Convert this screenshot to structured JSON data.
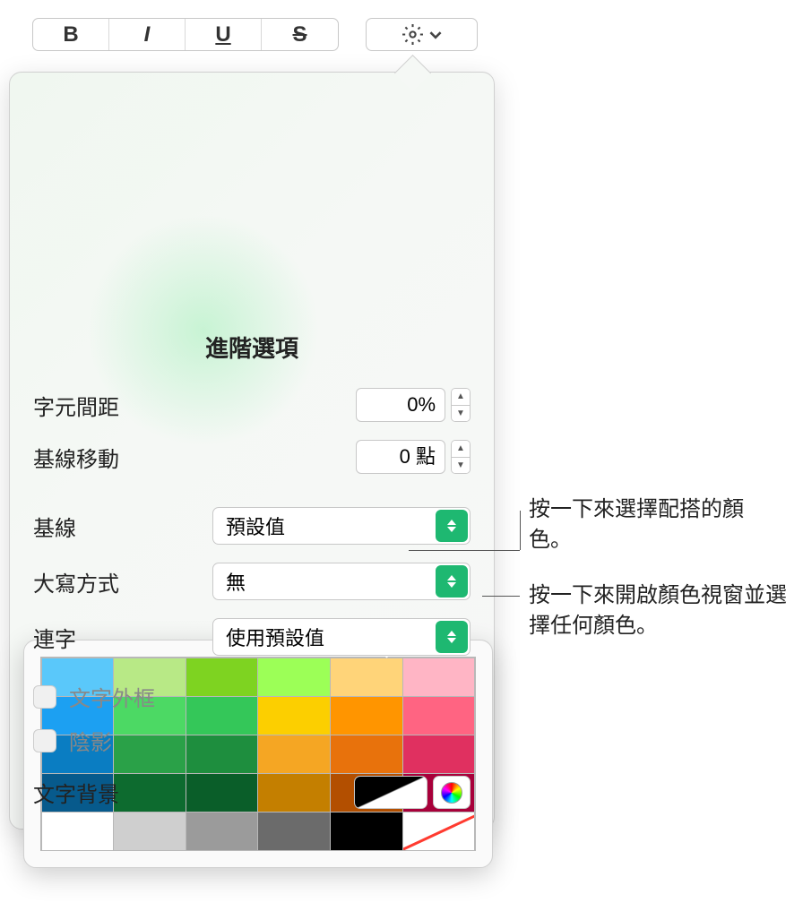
{
  "toolbar": {
    "bold": "B",
    "italic": "I",
    "underline": "U",
    "strike": "S"
  },
  "popover": {
    "title": "進階選項",
    "char_spacing": {
      "label": "字元間距",
      "value": "0%"
    },
    "baseline_shift": {
      "label": "基線移動",
      "value": "0 點"
    },
    "baseline": {
      "label": "基線",
      "value": "預設值"
    },
    "capitalize": {
      "label": "大寫方式",
      "value": "無"
    },
    "ligature": {
      "label": "連字",
      "value": "使用預設值"
    },
    "outline": {
      "label": "文字外框"
    },
    "shadow": {
      "label": "陰影"
    },
    "textbg": {
      "label": "文字背景"
    }
  },
  "swatches": {
    "row1": [
      "#5ac8fa",
      "#b8e986",
      "#7ed321",
      "#9cff57",
      "#ffd479",
      "#ffb5c5"
    ],
    "row2": [
      "#1ca0f2",
      "#4cd964",
      "#34c759",
      "#fccf00",
      "#ff9500",
      "#ff6482"
    ],
    "row3": [
      "#0a7dc2",
      "#2aa148",
      "#1e8e3e",
      "#f5a623",
      "#e8720c",
      "#e03060"
    ],
    "row4": [
      "#075a8c",
      "#0d6b2f",
      "#0a5e29",
      "#c47f00",
      "#b34f00",
      "#a8003a"
    ],
    "row5": [
      "#ffffff",
      "#cfcfcf",
      "#9b9b9b",
      "#6b6b6b",
      "#000000",
      "diag"
    ]
  },
  "callouts": {
    "c1": "按一下來選擇配搭的顏色。",
    "c2": "按一下來開啟顏色視窗並選擇任何顏色。"
  }
}
